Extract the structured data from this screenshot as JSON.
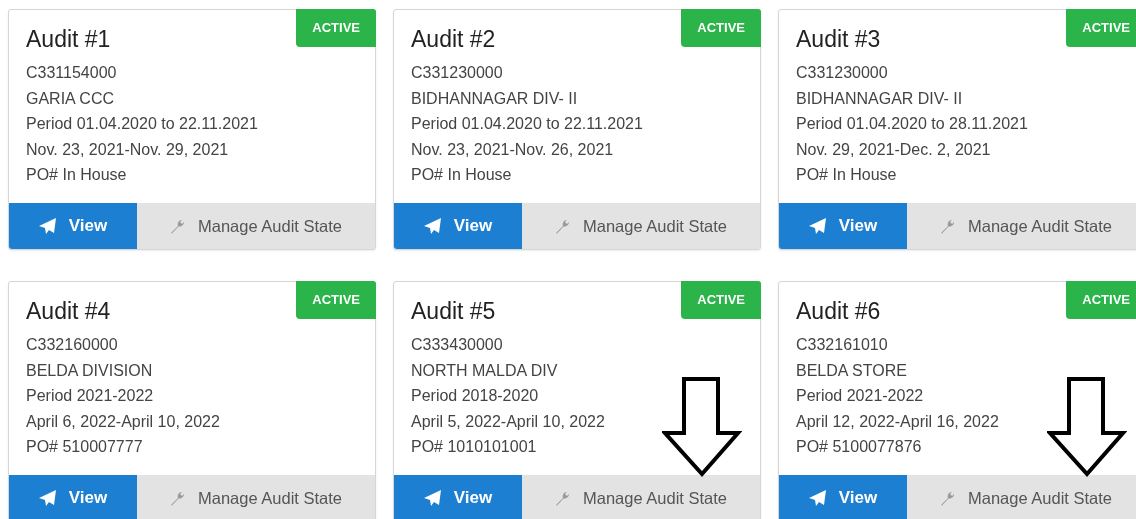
{
  "audits": [
    {
      "title": "Audit #1",
      "status": "ACTIVE",
      "lines": [
        "C331154000",
        "GARIA CCC",
        "Period 01.04.2020 to 22.11.2021",
        "Nov. 23, 2021-Nov. 29, 2021",
        "PO# In House"
      ],
      "view_label": "View",
      "manage_label": "Manage Audit State",
      "arrow_marked": false
    },
    {
      "title": "Audit #2",
      "status": "ACTIVE",
      "lines": [
        "C331230000",
        "BIDHANNAGAR DIV- II",
        "Period 01.04.2020 to 22.11.2021",
        "Nov. 23, 2021-Nov. 26, 2021",
        "PO# In House"
      ],
      "view_label": "View",
      "manage_label": "Manage Audit State",
      "arrow_marked": false
    },
    {
      "title": "Audit #3",
      "status": "ACTIVE",
      "lines": [
        "C331230000",
        "BIDHANNAGAR DIV- II",
        "Period 01.04.2020 to 28.11.2021",
        "Nov. 29, 2021-Dec. 2, 2021",
        "PO# In House"
      ],
      "view_label": "View",
      "manage_label": "Manage Audit State",
      "arrow_marked": false
    },
    {
      "title": "Audit #4",
      "status": "ACTIVE",
      "lines": [
        "C332160000",
        "BELDA DIVISION",
        "Period 2021-2022",
        "April 6, 2022-April 10, 2022",
        "PO# 510007777"
      ],
      "view_label": "View",
      "manage_label": "Manage Audit State",
      "arrow_marked": false
    },
    {
      "title": "Audit #5",
      "status": "ACTIVE",
      "lines": [
        "C333430000",
        "NORTH MALDA DIV",
        "Period 2018-2020",
        "April 5, 2022-April 10, 2022",
        "PO# 1010101001"
      ],
      "view_label": "View",
      "manage_label": "Manage Audit State",
      "arrow_marked": true
    },
    {
      "title": "Audit #6",
      "status": "ACTIVE",
      "lines": [
        "C332161010",
        "BELDA STORE",
        "Period 2021-2022",
        "April 12, 2022-April 16, 2022",
        "PO# 5100077876"
      ],
      "view_label": "View",
      "manage_label": "Manage Audit State",
      "arrow_marked": true
    }
  ]
}
